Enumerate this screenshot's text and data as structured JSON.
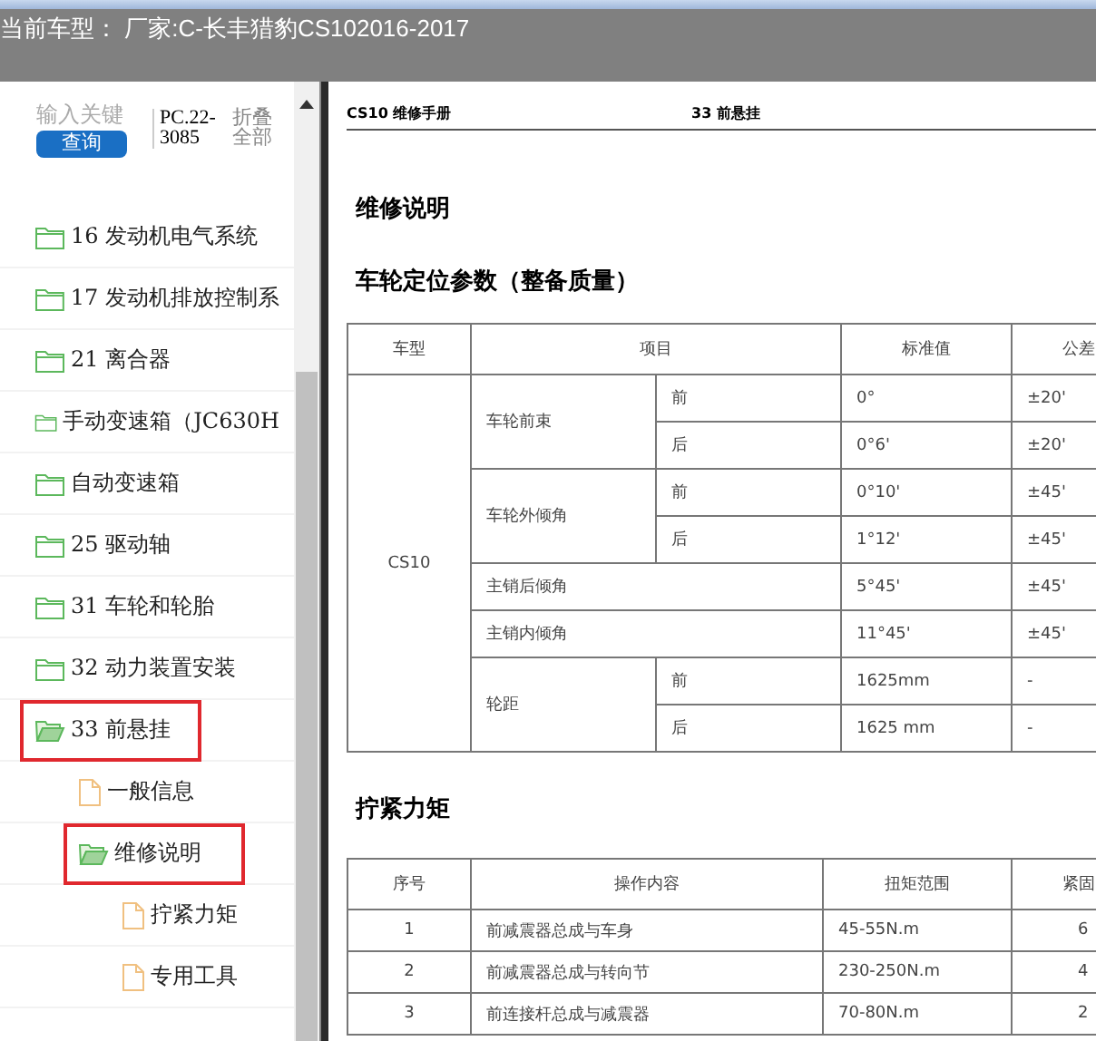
{
  "header": {
    "title": "当前车型：  厂家:C-长丰猎豹CS102016-2017"
  },
  "search": {
    "placeholder": "输入关键",
    "button": "查询",
    "code": "PC.22-3085",
    "collapse": "折叠全部"
  },
  "tree": [
    {
      "label": "16 发动机电气系统",
      "kind": "folder",
      "expanded": false,
      "selected": false
    },
    {
      "label": "17 发动机排放控制系",
      "kind": "folder",
      "expanded": false,
      "selected": false
    },
    {
      "label": "21 离合器",
      "kind": "folder",
      "expanded": false,
      "selected": false
    },
    {
      "label": "手动变速箱（JC630H",
      "kind": "folder",
      "expanded": false,
      "selected": false
    },
    {
      "label": "自动变速箱",
      "kind": "folder",
      "expanded": false,
      "selected": false
    },
    {
      "label": "25 驱动轴",
      "kind": "folder",
      "expanded": false,
      "selected": false
    },
    {
      "label": "31 车轮和轮胎",
      "kind": "folder",
      "expanded": false,
      "selected": false
    },
    {
      "label": "32 动力装置安装",
      "kind": "folder",
      "expanded": false,
      "selected": false
    },
    {
      "label": "33 前悬挂",
      "kind": "folder",
      "expanded": true,
      "selected": true,
      "children": [
        {
          "label": "一般信息",
          "kind": "doc",
          "expanded": false,
          "selected": false
        },
        {
          "label": "维修说明",
          "kind": "folder",
          "expanded": true,
          "selected": true,
          "children": [
            {
              "label": "拧紧力矩",
              "kind": "doc",
              "expanded": false,
              "selected": false
            },
            {
              "label": "专用工具",
              "kind": "doc",
              "expanded": false,
              "selected": false
            }
          ]
        }
      ]
    }
  ],
  "document": {
    "header_left": "CS10 维修手册",
    "header_right": "33 前悬挂",
    "title": "维修说明",
    "section_1": "车轮定位参数（整备质量）",
    "alignment_table": {
      "columns": [
        "车型",
        "项目",
        "标准值",
        "公差"
      ],
      "model": "CS10",
      "groups": [
        {
          "item": "车轮前束",
          "subs": [
            {
              "position": "前",
              "standard": "0°",
              "tolerance": "±20'"
            },
            {
              "position": "后",
              "standard": "0°6'",
              "tolerance": "±20'"
            }
          ]
        },
        {
          "item": "车轮外倾角",
          "subs": [
            {
              "position": "前",
              "standard": "0°10'",
              "tolerance": "±45'"
            },
            {
              "position": "后",
              "standard": "1°12'",
              "tolerance": "±45'"
            }
          ]
        },
        {
          "item": "主销后倾角",
          "standard": "5°45'",
          "tolerance": "±45'"
        },
        {
          "item": "主销内倾角",
          "standard": "11°45'",
          "tolerance": "±45'"
        },
        {
          "item": "轮距",
          "subs": [
            {
              "position": "前",
              "standard": "1625mm",
              "tolerance": "-"
            },
            {
              "position": "后",
              "standard": "1625 mm",
              "tolerance": "-"
            }
          ]
        }
      ]
    },
    "section_2": "拧紧力矩",
    "torque_table": {
      "columns": [
        "序号",
        "操作内容",
        "扭矩范围",
        "紧固"
      ],
      "rows": [
        [
          "1",
          "前减震器总成与车身",
          "45-55N.m",
          "6"
        ],
        [
          "2",
          "前减震器总成与转向节",
          "230-250N.m",
          "4"
        ],
        [
          "3",
          "前连接杆总成与减震器",
          "70-80N.m",
          "2"
        ]
      ]
    }
  }
}
